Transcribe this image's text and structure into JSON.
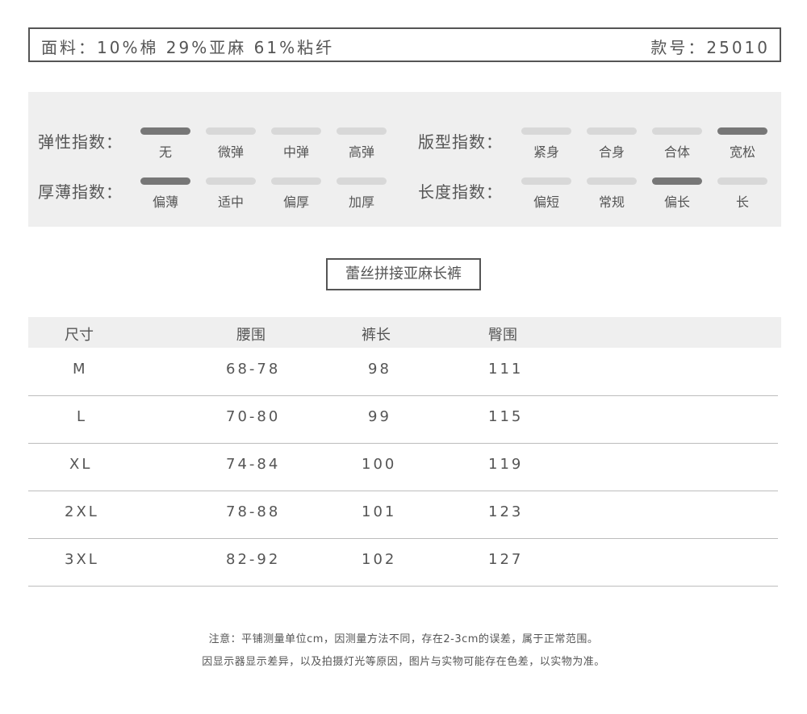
{
  "header": {
    "fabric": "面料：10%棉 29%亚麻 61%粘纤",
    "style_no": "款号：25010"
  },
  "indices": {
    "elasticity": {
      "label": "弹性指数：",
      "options": [
        "无",
        "微弹",
        "中弹",
        "高弹"
      ],
      "selected": "无"
    },
    "fit": {
      "label": "版型指数：",
      "options": [
        "紧身",
        "合身",
        "合体",
        "宽松"
      ],
      "selected": "宽松"
    },
    "thickness": {
      "label": "厚薄指数：",
      "options": [
        "偏薄",
        "适中",
        "偏厚",
        "加厚"
      ],
      "selected": "偏薄"
    },
    "length": {
      "label": "长度指数：",
      "options": [
        "偏短",
        "常规",
        "偏长",
        "长"
      ],
      "selected": "偏长"
    }
  },
  "product_title": "蕾丝拼接亚麻长裤",
  "size_table": {
    "headers": [
      "尺寸",
      "腰围",
      "裤长",
      "臀围"
    ],
    "rows": [
      [
        "M",
        "68-78",
        "98",
        "111"
      ],
      [
        "L",
        "70-80",
        "99",
        "115"
      ],
      [
        "XL",
        "74-84",
        "100",
        "119"
      ],
      [
        "2XL",
        "78-88",
        "101",
        "123"
      ],
      [
        "3XL",
        "82-92",
        "102",
        "127"
      ]
    ]
  },
  "notes": [
    "注意：平铺测量单位cm，因测量方法不同，存在2-3cm的误差，属于正常范围。",
    "因显示器显示差异，以及拍摄灯光等原因，图片与实物可能存在色差，以实物为准。"
  ],
  "colors": {
    "text": "#555555",
    "bar_active": "#777777",
    "bar_inactive": "#d8d8d8",
    "panel_bg": "#efefef"
  }
}
